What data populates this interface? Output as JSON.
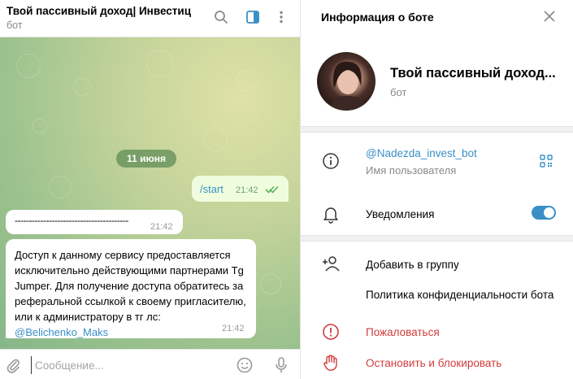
{
  "chat": {
    "title": "Твой пассивный доход| Инвестиц",
    "subtitle": "бот",
    "date_badge": "11 июня",
    "outgoing": {
      "text": "/start",
      "time": "21:42"
    },
    "incoming_1": {
      "text": "----------------------------------------",
      "time": "21:42"
    },
    "incoming_2": {
      "text": "Доступ к данному сервису предоставляется исключительно действующими партнерами Tg Jumper. Для получение доступа обратитесь за реферальной ссылкой к своему пригласителю, или к администратору в тг лс: ",
      "link": "@Belichenko_Maks",
      "time": "21:42"
    },
    "composer": {
      "placeholder": "Сообщение..."
    }
  },
  "info": {
    "title": "Информация о боте",
    "bot_name": "Твой пассивный доход...",
    "bot_subtitle": "бот",
    "username": "@Nadezda_invest_bot",
    "username_caption": "Имя пользователя",
    "notifications_label": "Уведомления",
    "notifications_on": true,
    "add_to_group": "Добавить в группу",
    "privacy_policy": "Политика конфиденциальности бота",
    "report": "Пожаловаться",
    "stop_block": "Остановить и блокировать"
  },
  "colors": {
    "accent": "#3a8fc6",
    "danger": "#d33b3b",
    "outgoing_bubble": "#effdde",
    "date_badge": "#5f8c55"
  }
}
